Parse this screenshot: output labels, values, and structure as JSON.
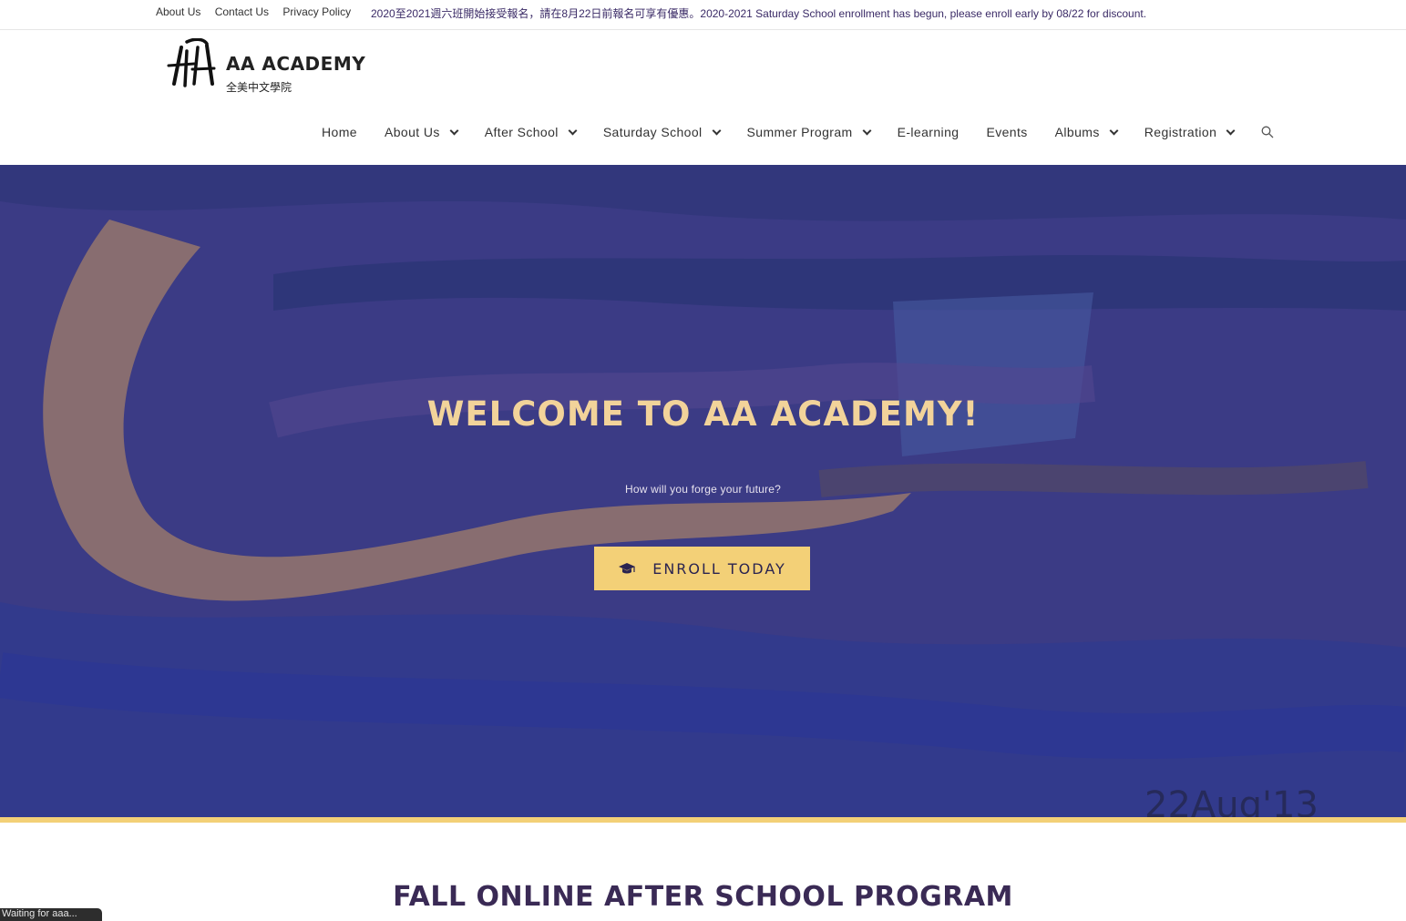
{
  "topbar": {
    "links": [
      "About Us",
      "Contact Us",
      "Privacy Policy"
    ],
    "notice": "2020至2021週六班開始接受報名，請在8月22日前報名可享有優惠。2020-2021 Saturday School enrollment has begun, please enroll early by 08/22 for discount."
  },
  "brand": {
    "name": "AA ACADEMY",
    "name_zh": "全美中文學院"
  },
  "nav": {
    "home": "Home",
    "about": "About Us",
    "after_school": "After School",
    "saturday": "Saturday School",
    "summer": "Summer Program",
    "elearning": "E-learning",
    "events": "Events",
    "albums": "Albums",
    "registration": "Registration"
  },
  "hero": {
    "title": "WELCOME TO AA ACADEMY!",
    "subtitle": "How will you forge your future?",
    "button": "ENROLL TODAY",
    "watermark": "22Aug'13"
  },
  "section": {
    "title": "FALL ONLINE AFTER SCHOOL PROGRAM"
  },
  "status_bar": "Waiting for aaa..."
}
